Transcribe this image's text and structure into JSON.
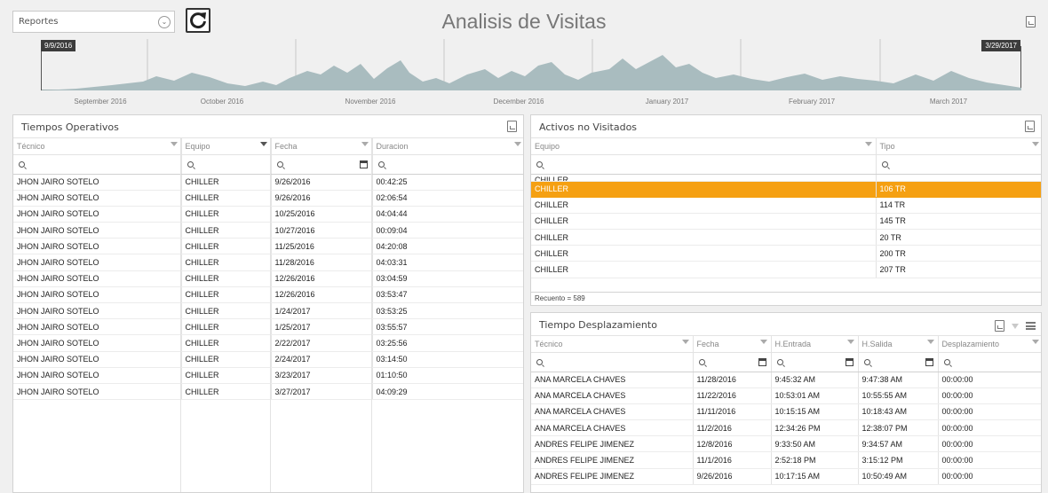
{
  "toolbar": {
    "report_select_value": "Reportes",
    "title": "Analisis de Visitas"
  },
  "timeline": {
    "range_start": "9/9/2016",
    "range_end": "3/29/2017",
    "months": [
      "September 2016",
      "October 2016",
      "November 2016",
      "December 2016",
      "January 2017",
      "February 2017",
      "March 2017"
    ]
  },
  "tiempos_operativos": {
    "title": "Tiempos Operativos",
    "columns": [
      "Técnico",
      "Equipo",
      "Fecha",
      "Duracion"
    ],
    "rows": [
      [
        "JHON JAIRO SOTELO",
        "CHILLER",
        "9/26/2016",
        "00:42:25"
      ],
      [
        "JHON JAIRO SOTELO",
        "CHILLER",
        "9/26/2016",
        "02:06:54"
      ],
      [
        "JHON JAIRO SOTELO",
        "CHILLER",
        "10/25/2016",
        "04:04:44"
      ],
      [
        "JHON JAIRO SOTELO",
        "CHILLER",
        "10/27/2016",
        "00:09:04"
      ],
      [
        "JHON JAIRO SOTELO",
        "CHILLER",
        "11/25/2016",
        "04:20:08"
      ],
      [
        "JHON JAIRO SOTELO",
        "CHILLER",
        "11/28/2016",
        "04:03:31"
      ],
      [
        "JHON JAIRO SOTELO",
        "CHILLER",
        "12/26/2016",
        "03:04:59"
      ],
      [
        "JHON JAIRO SOTELO",
        "CHILLER",
        "12/26/2016",
        "03:53:47"
      ],
      [
        "JHON JAIRO SOTELO",
        "CHILLER",
        "1/24/2017",
        "03:53:25"
      ],
      [
        "JHON JAIRO SOTELO",
        "CHILLER",
        "1/25/2017",
        "03:55:57"
      ],
      [
        "JHON JAIRO SOTELO",
        "CHILLER",
        "2/22/2017",
        "03:25:56"
      ],
      [
        "JHON JAIRO SOTELO",
        "CHILLER",
        "2/24/2017",
        "03:14:50"
      ],
      [
        "JHON JAIRO SOTELO",
        "CHILLER",
        "3/23/2017",
        "01:10:50"
      ],
      [
        "JHON JAIRO SOTELO",
        "CHILLER",
        "3/27/2017",
        "04:09:29"
      ]
    ]
  },
  "activos": {
    "title": "Activos no Visitados",
    "columns": [
      "Equipo",
      "Tipo"
    ],
    "partial_row": [
      "CHILLER",
      ""
    ],
    "rows": [
      [
        "CHILLER",
        "106 TR"
      ],
      [
        "CHILLER",
        "114 TR"
      ],
      [
        "CHILLER",
        "145 TR"
      ],
      [
        "CHILLER",
        "20 TR"
      ],
      [
        "CHILLER",
        "200 TR"
      ],
      [
        "CHILLER",
        "207 TR"
      ]
    ],
    "selected_index": 0,
    "recuento": "Recuento = 589"
  },
  "desplazamiento": {
    "title": "Tiempo Desplazamiento",
    "columns": [
      "Técnico",
      "Fecha",
      "H.Entrada",
      "H.Salida",
      "Desplazamiento"
    ],
    "rows": [
      [
        "ANA MARCELA CHAVES",
        "11/28/2016",
        "9:45:32 AM",
        "9:47:38 AM",
        "00:00:00"
      ],
      [
        "ANA MARCELA CHAVES",
        "11/22/2016",
        "10:53:01 AM",
        "10:55:55 AM",
        "00:00:00"
      ],
      [
        "ANA MARCELA CHAVES",
        "11/11/2016",
        "10:15:15 AM",
        "10:18:43 AM",
        "00:00:00"
      ],
      [
        "ANA MARCELA CHAVES",
        "11/2/2016",
        "12:34:26 PM",
        "12:38:07 PM",
        "00:00:00"
      ],
      [
        "ANDRES FELIPE JIMENEZ",
        "12/8/2016",
        "9:33:50 AM",
        "9:34:57 AM",
        "00:00:00"
      ],
      [
        "ANDRES FELIPE JIMENEZ",
        "11/1/2016",
        "2:52:18 PM",
        "3:15:12 PM",
        "00:00:00"
      ],
      [
        "ANDRES FELIPE JIMENEZ",
        "9/26/2016",
        "10:17:15 AM",
        "10:50:49 AM",
        "00:00:00"
      ]
    ]
  },
  "colors": {
    "accent_selected": "#f5a012",
    "timeline_fill": "#a9bcbf"
  },
  "icons": [
    "chevron-down-icon",
    "refresh-icon",
    "export-icon",
    "filter-icon",
    "search-icon",
    "calendar-icon",
    "column-chooser-icon"
  ]
}
